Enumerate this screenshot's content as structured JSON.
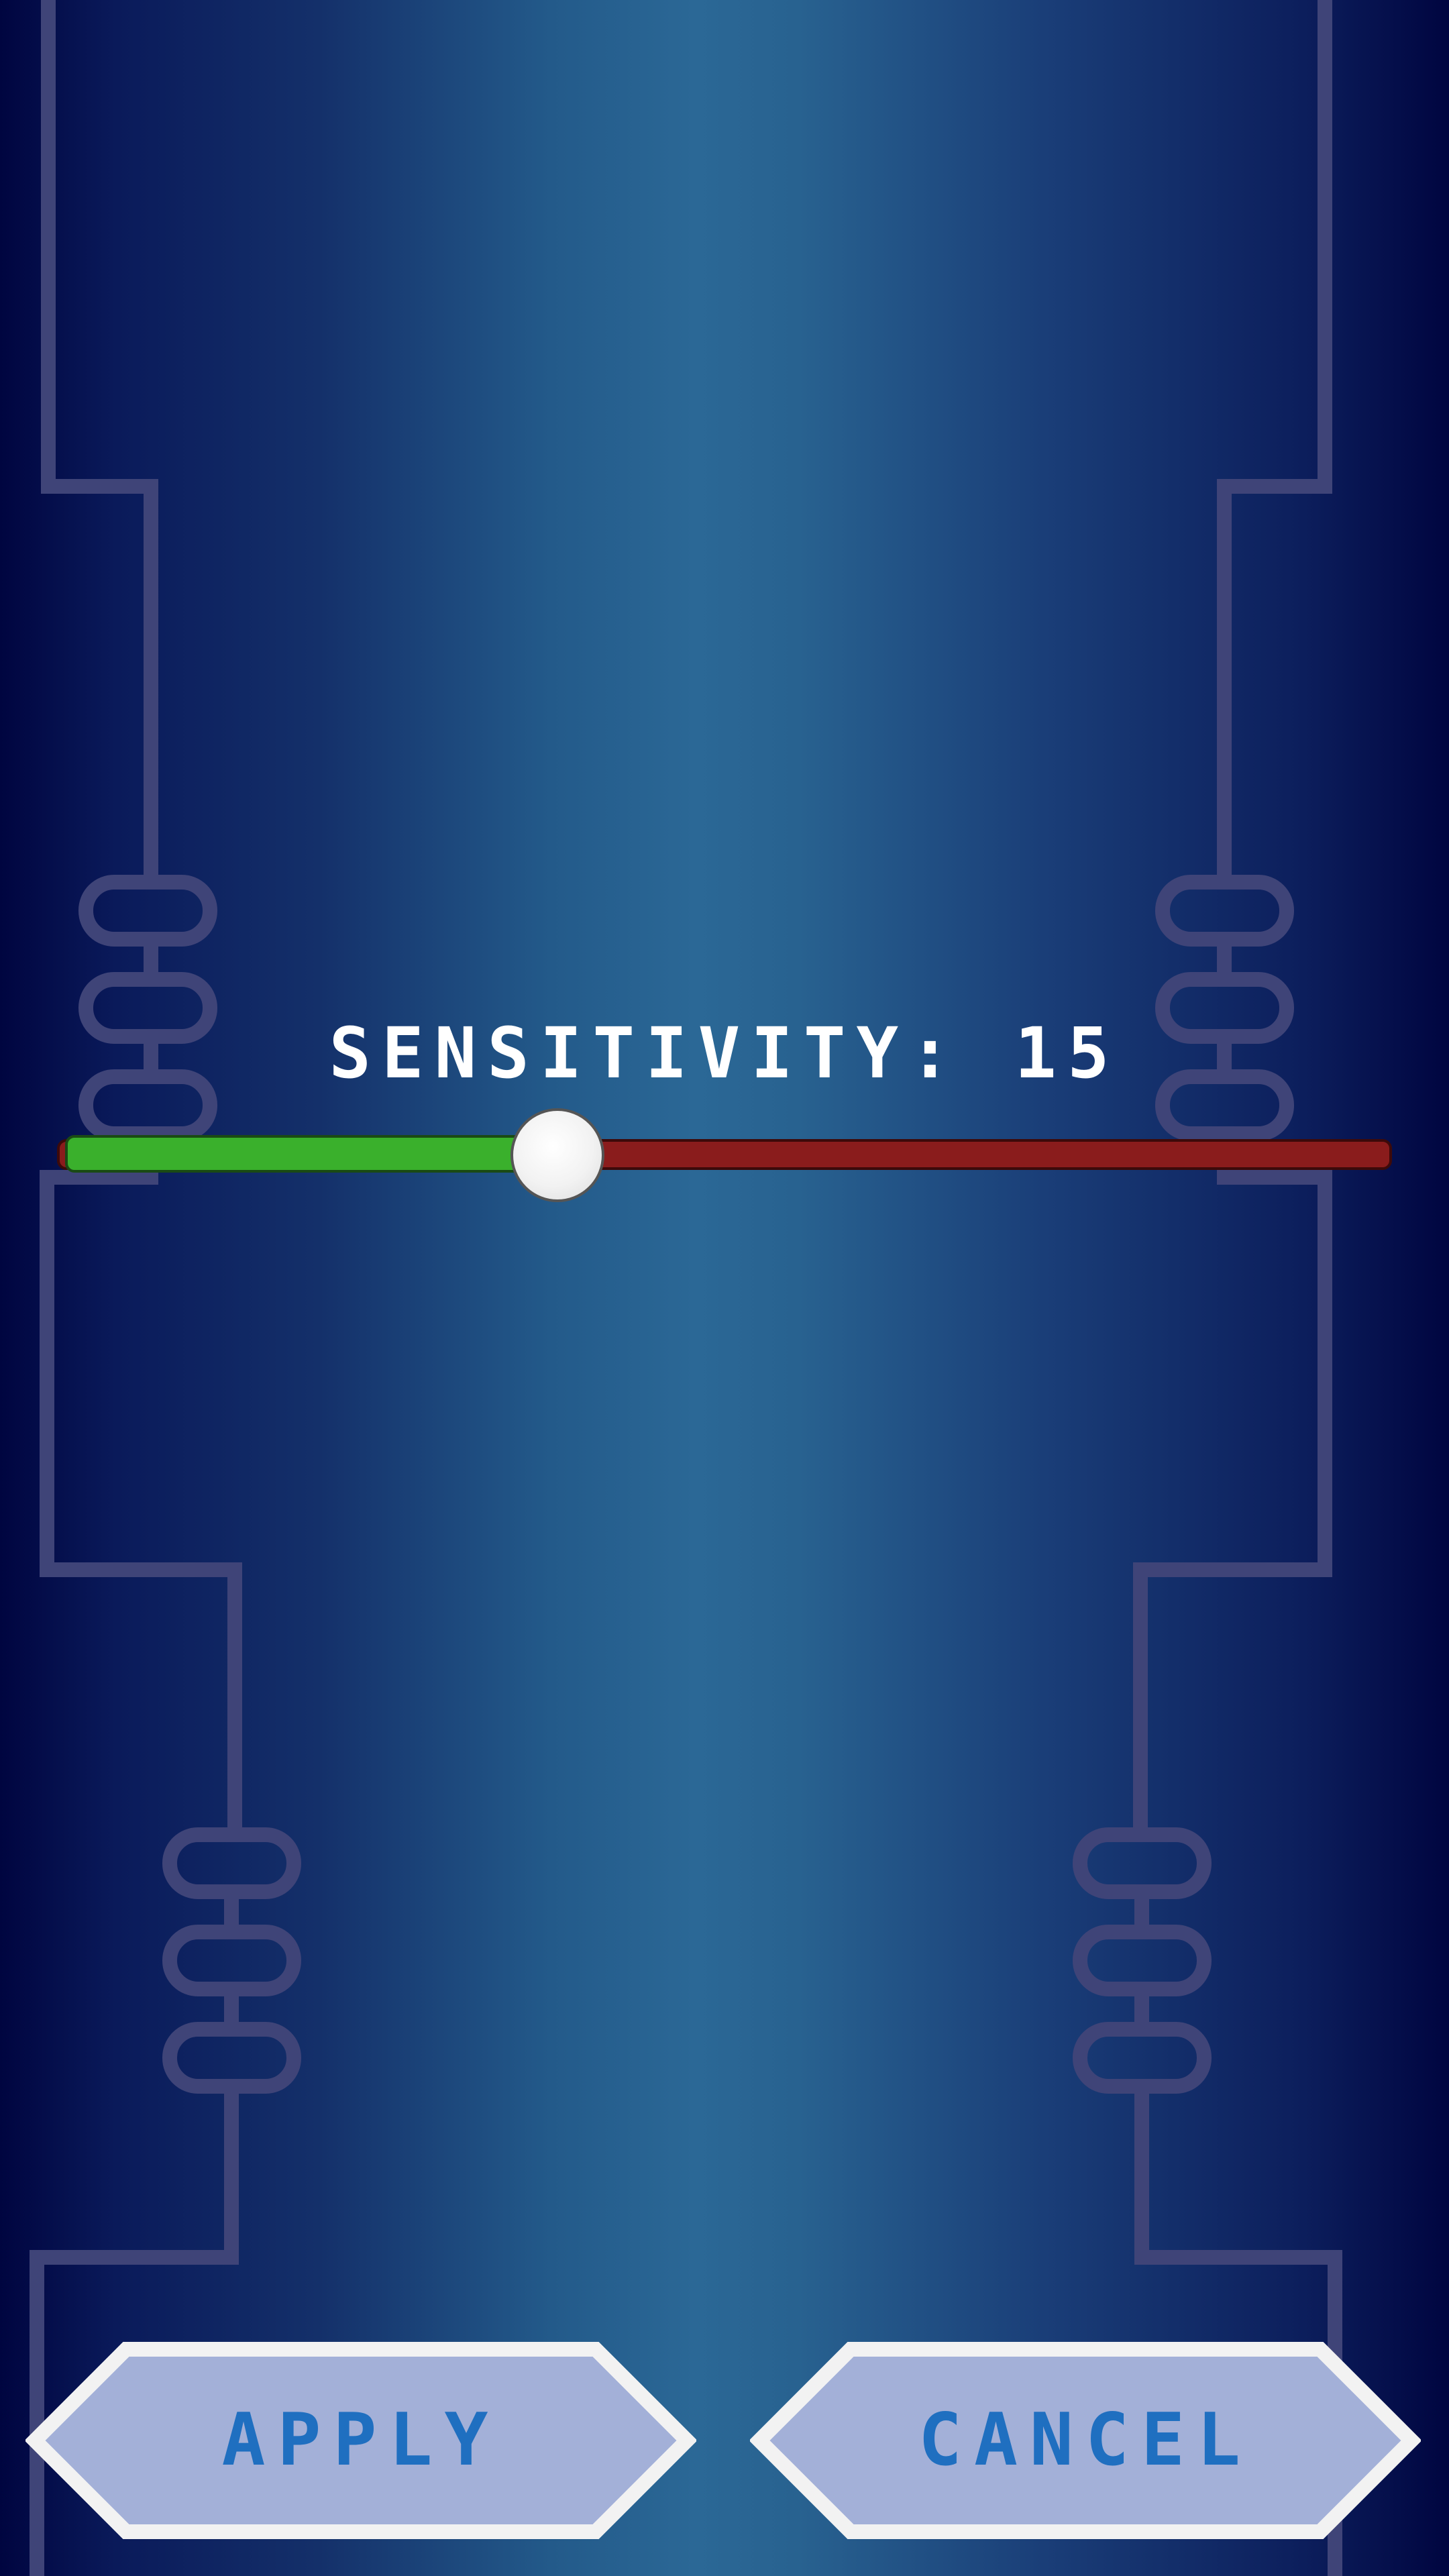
{
  "screen": {
    "title": "SENSITIVITY: 15"
  },
  "slider": {
    "value": 15,
    "min": 0,
    "max": 40,
    "fill_color": "#3ab02c",
    "track_color": "#8a1c1c",
    "thumb_color": "#f5f5f5"
  },
  "buttons": {
    "apply_label": "APPLY",
    "cancel_label": "CANCEL",
    "fill_color": "#a3b0d8",
    "border_color": "#f2f2f2",
    "text_color": "#1f6fc0"
  },
  "decor": {
    "circuit_color": "#3f4478"
  }
}
